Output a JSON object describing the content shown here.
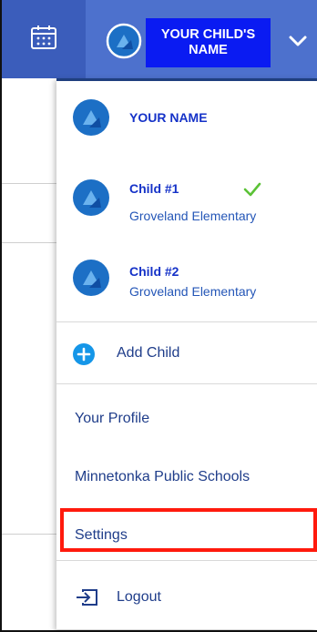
{
  "header": {
    "child_name_button": "YOUR CHILD'S NAME",
    "child_name_line1": "YOUR CHILD'S",
    "child_name_line2": "NAME",
    "icons": {
      "calendar": "calendar-icon",
      "avatar": "avatar-icon",
      "chevron": "chevron-down-icon"
    }
  },
  "dropdown": {
    "user": {
      "name": "YOUR NAME"
    },
    "children": [
      {
        "name": "Child #1",
        "school": "Groveland Elementary",
        "selected": true
      },
      {
        "name": "Child #2",
        "school": "Groveland Elementary",
        "selected": false
      }
    ],
    "add_child_label": "Add Child",
    "menu": {
      "your_profile": "Your Profile",
      "district": "Minnetonka Public Schools",
      "settings": "Settings",
      "logout": "Logout"
    }
  },
  "colors": {
    "topbar": "#3b5dbb",
    "profile_cell": "#4d71cd",
    "name_box": "#0a1bf2",
    "accent_text": "#1532c8",
    "highlight": "#ff1a0d",
    "check": "#5bc236"
  }
}
